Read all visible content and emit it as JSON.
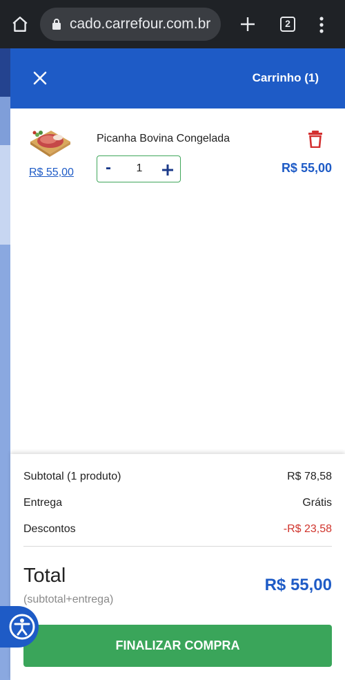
{
  "browser": {
    "url": "cado.carrefour.com.br",
    "tab_count": "2",
    "icons": [
      "home-icon",
      "lock-icon",
      "new-tab-icon",
      "tabs-icon",
      "menu-icon"
    ]
  },
  "cart": {
    "title": "Carrinho (1)",
    "items": [
      {
        "name": "Picanha Bovina Congelada",
        "unit_price": "R$ 55,00",
        "quantity": "1",
        "minus_label": "-",
        "line_total": "R$ 55,00"
      }
    ],
    "summary": {
      "subtotal_label": "Subtotal (1 produto)",
      "subtotal_value": "R$ 78,58",
      "shipping_label": "Entrega",
      "shipping_value": "Grátis",
      "discount_label": "Descontos",
      "discount_value": "-R$ 23,58",
      "total_label": "Total",
      "total_note": "(subtotal+entrega)",
      "total_value": "R$ 55,00",
      "checkout_label": "FINALIZAR COMPRA"
    }
  },
  "colors": {
    "header": "#1e5bc6",
    "accent_green": "#3aa55a",
    "discount_red": "#d0342c",
    "trash_red": "#d32f2f"
  }
}
